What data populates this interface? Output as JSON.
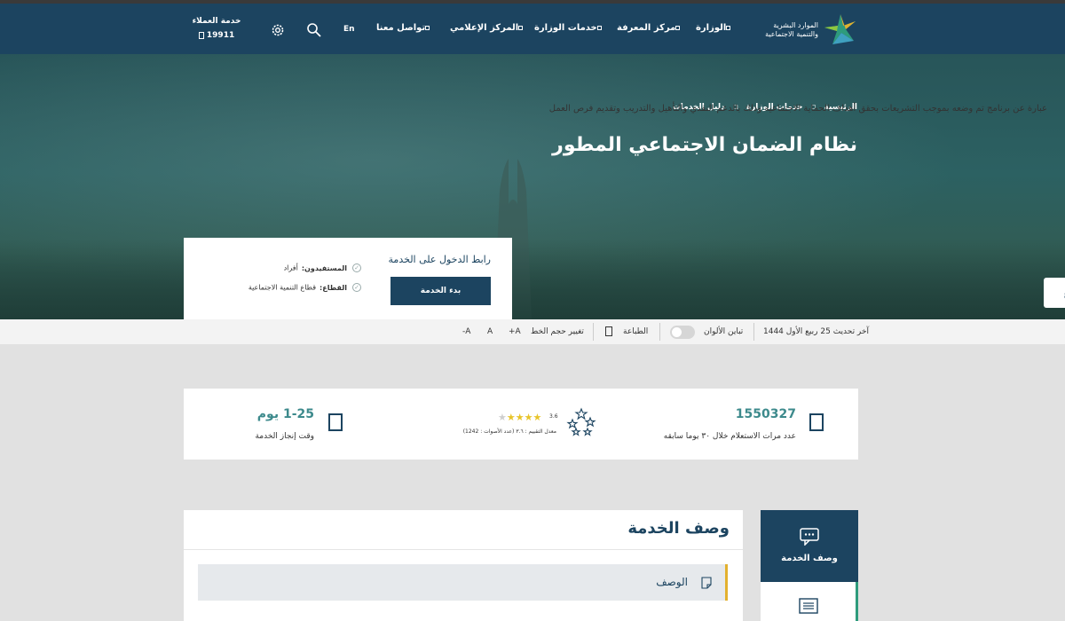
{
  "header": {
    "logo_line1": "الموارد البشرية",
    "logo_line2": "والتنمية الاجتماعية",
    "nav": [
      {
        "label": "الوزارة"
      },
      {
        "label": "مركز المعرفة"
      },
      {
        "label": "خدمات الوزارة"
      },
      {
        "label": "المركز الإعلامي"
      },
      {
        "label": "تواصل معنا"
      }
    ],
    "lang": "En",
    "customer_service_label": "خدمة العملاء",
    "customer_service_number": "19911",
    "icons": {
      "search": "search-icon",
      "settings": "gear-icon",
      "phone": "phone-icon"
    }
  },
  "hero": {
    "breadcrumb": [
      "الرئيسية",
      "خدمات الوزارة",
      "دليل الخدمات"
    ],
    "title": "نظام الضمان الاجتماعي المطور",
    "side_tab": "ع"
  },
  "service_box": {
    "title": "رابط الدخول على الخدمة",
    "start_button": "بدء الخدمة",
    "beneficiaries_label": "المستفيدون:",
    "beneficiaries_value": "أفراد",
    "sector_label": "القطاع:",
    "sector_value": "قطاع التنمية الاجتماعية"
  },
  "toolbar": {
    "last_update": "آخر تحديث 25 ربيع الأول 1444",
    "contrast": "تباين الألوان",
    "print": "الطباعة",
    "font_size": "تغيير حجم الخط",
    "font_inc": "A+",
    "font_normal": "A",
    "font_dec": "A-",
    "contrast_on": false
  },
  "stats": {
    "inquiries_number": "1550327",
    "inquiries_label": "عدد مرات الاستعلام خلال ٣٠ يوما سابقه",
    "rating_value": "3.6",
    "rating_stars": 4,
    "rating_max": 5,
    "rating_label": "معدل التقييم : ٣.٦ (عدد الأصوات : 1242)",
    "duration_number": "1-25 يوم",
    "duration_label": "وقت إنجاز الخدمة"
  },
  "side_menu": {
    "active_label": "وصف الخدمة",
    "active_icon": "chat-icon",
    "next_icon": "document-icon"
  },
  "content": {
    "title": "وصف الخدمة",
    "section_label": "الوصف",
    "section_icon": "note-icon",
    "text": "عبارة عن برنامج تم وضعه بموجب التشريعات بحقق أهداف الحماية الاجتماعية وذلك بالدعم النقدي والتأهيل والتدريب وتقديم فرص العمل"
  },
  "colors": {
    "primary": "#1c4460",
    "accent_teal": "#3d8a8c",
    "accent_gold": "#e3b12f",
    "accent_green": "#2e9b7c"
  }
}
